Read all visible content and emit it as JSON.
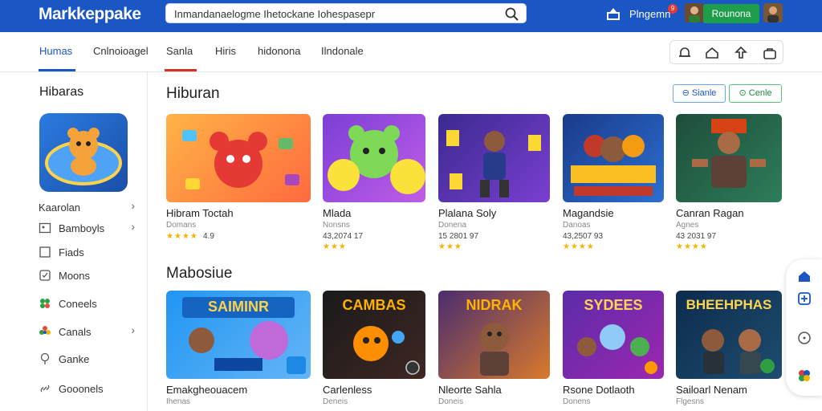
{
  "app": {
    "logo": "Markkeppake",
    "search_value": "Inmandanaelogme Ihetockane Iohespasepr",
    "program_label": "Plngemn",
    "badge_count": "9",
    "account_button": "Rounona"
  },
  "tabs": [
    {
      "label": "Humas"
    },
    {
      "label": "Cnlnoioagel"
    },
    {
      "label": "Sanla"
    },
    {
      "label": "Hiris"
    },
    {
      "label": "hidonona"
    },
    {
      "label": "Ilndonale"
    }
  ],
  "sidebar": {
    "title": "Hibaras",
    "featured_label": "Kaarolan",
    "items": [
      {
        "label": "Bamboyls",
        "icon": "image-icon"
      },
      {
        "label": "Fiads",
        "icon": "square-icon"
      },
      {
        "label": "Moons",
        "icon": "check-icon"
      },
      {
        "label": "Coneels",
        "icon": "clover-icon"
      },
      {
        "label": "Canals",
        "icon": "flower-icon"
      },
      {
        "label": "Ganke",
        "icon": "pin-icon"
      },
      {
        "label": "Gooonels",
        "icon": "link-icon"
      }
    ]
  },
  "section1": {
    "title": "Hiburan",
    "filter_a": "Sianle",
    "filter_b": "Cenle",
    "cards": [
      {
        "title": "Hibram Toctah",
        "sub": "Domans",
        "rating": "4.9",
        "stars": "★★★★"
      },
      {
        "title": "Mlada",
        "sub": "Nonsns",
        "rating": "43,2074 17",
        "stars": "★★★"
      },
      {
        "title": "Plalana Soly",
        "sub": "Donena",
        "rating": "15 2801 97",
        "stars": "★★★"
      },
      {
        "title": "Magandsie",
        "sub": "Danoas",
        "rating": "43,2507 93",
        "stars": "★★★★"
      },
      {
        "title": "Canran Ragan",
        "sub": "Agnes",
        "rating": "43 2031 97",
        "stars": "★★★★"
      }
    ]
  },
  "section2": {
    "title": "Mabosiue",
    "cards": [
      {
        "title": "Emakgheouacem",
        "sub": "Ihenas",
        "banner": "SAIMINR"
      },
      {
        "title": "Carlenless",
        "sub": "Deneis",
        "banner": "CAMBAS"
      },
      {
        "title": "Nleorte Sahla",
        "sub": "Doneis",
        "banner": "NIDRAK"
      },
      {
        "title": "Rsone Dotlaoth",
        "sub": "Donens",
        "banner": "SYDEES"
      },
      {
        "title": "Sailoarl Nenam",
        "sub": "Flgesns",
        "banner": "BHEEHPHAS"
      }
    ]
  },
  "colors": {
    "brand_blue": "#1a56c4",
    "accent_green": "#1e9e4a",
    "star_yellow": "#f4b400"
  }
}
